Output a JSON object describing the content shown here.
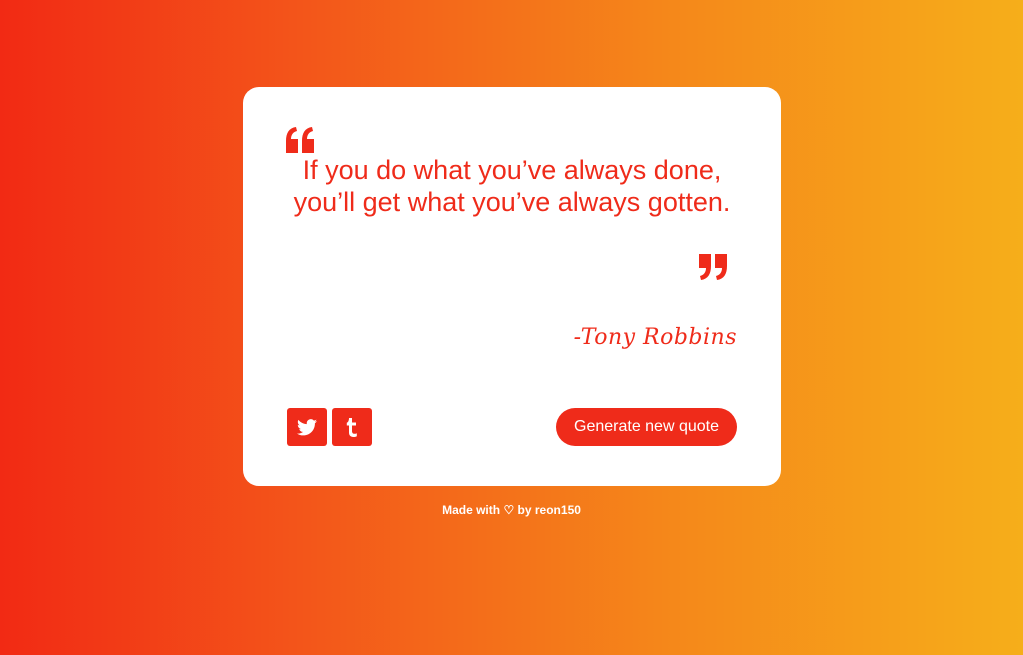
{
  "colors": {
    "accent": "#ef2b1a",
    "card_background": "#ffffff",
    "gradient_start": "#f22a14",
    "gradient_end": "#f6ae1a"
  },
  "quote": {
    "text": "If you do what you’ve always done, you’ll get what you’ve always gotten.",
    "author": "-Tony Robbins",
    "open_icon": "quote-left-icon",
    "close_icon": "quote-right-icon"
  },
  "actions": {
    "twitter_icon": "twitter-icon",
    "tumblr_icon": "tumblr-icon",
    "generate_label": "Generate new quote"
  },
  "footer": {
    "made_with": "Made with",
    "heart_icon": "heart-icon",
    "heart_glyph": "♡",
    "by_text": "by reon150"
  }
}
